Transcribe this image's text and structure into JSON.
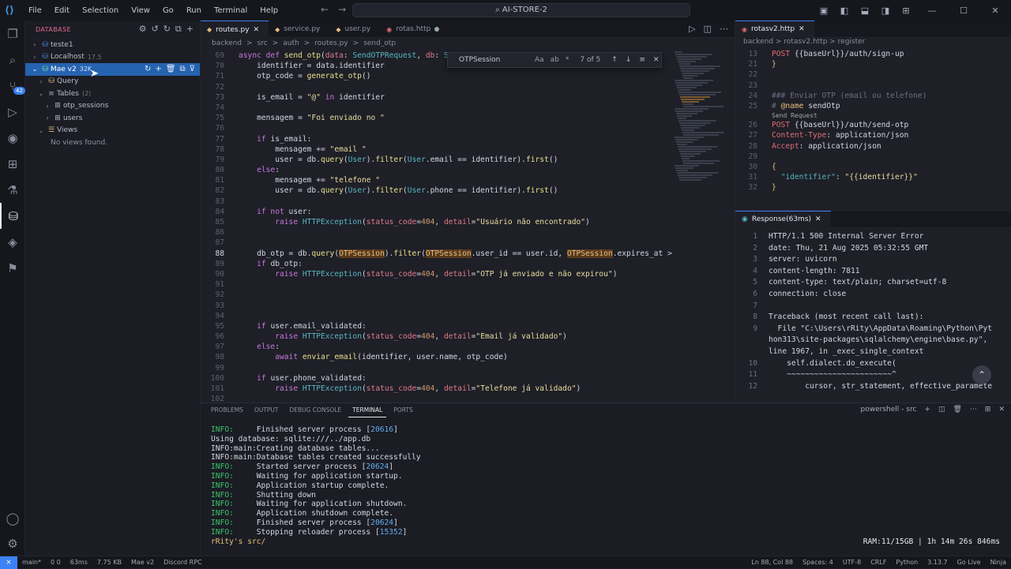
{
  "titlebar": {
    "search": "AI-STORE-2",
    "menu": [
      "File",
      "Edit",
      "Selection",
      "View",
      "Go",
      "Run",
      "Terminal",
      "Help"
    ]
  },
  "sidebar": {
    "title": "DATABASE",
    "connections": [
      {
        "label": "teste1",
        "extra": ""
      },
      {
        "label": "Localhost",
        "extra": "17.5"
      },
      {
        "label": "Mae v2",
        "extra": "32K"
      }
    ],
    "query": "Query",
    "tables_label": "Tables",
    "tables_count": "(2)",
    "tables": [
      "otp_sessions",
      "users"
    ],
    "views": "Views",
    "no_views": "No views found."
  },
  "tabs": [
    {
      "label": "routes.py",
      "type": "py",
      "active": true
    },
    {
      "label": "service.py",
      "type": "py"
    },
    {
      "label": "user.py",
      "type": "py"
    },
    {
      "label": "rotas.http",
      "type": "http",
      "modified": true
    }
  ],
  "breadcrumb": [
    "backend",
    ">",
    "src",
    ">",
    "auth",
    ">",
    "routes.py",
    ">",
    "send_otp"
  ],
  "find": {
    "value": "OTPSession",
    "count": "7 of 5",
    "options": [
      "Aa",
      "ab",
      "*"
    ]
  },
  "code": [
    {
      "n": "69",
      "html": "<span class='kw'>async def</span> <span class='fn'>send_otp</span>(<span class='prm'>data</span>: <span class='cls'>SendOTPRequest</span>, <span class='prm'>db</span>: <span class='cls'>S</span>"
    },
    {
      "n": "70",
      "html": "    identifier = data.identifier"
    },
    {
      "n": "71",
      "html": "    otp_code = <span class='fn'>generate_otp</span>()"
    },
    {
      "n": "72",
      "html": ""
    },
    {
      "n": "73",
      "html": "    is_email = <span class='str'>\"@\"</span> <span class='kw'>in</span> identifier"
    },
    {
      "n": "74",
      "html": ""
    },
    {
      "n": "75",
      "html": "    mensagem = <span class='str'>\"Foi enviado no \"</span>"
    },
    {
      "n": "76",
      "html": ""
    },
    {
      "n": "77",
      "html": "    <span class='kw'>if</span> is_email:"
    },
    {
      "n": "78",
      "html": "        mensagem += <span class='str'>\"email \"</span>"
    },
    {
      "n": "79",
      "html": "        user = db.<span class='fn'>query</span>(<span class='cls'>User</span>).<span class='fn'>filter</span>(<span class='cls'>User</span>.email == identifier).<span class='fn'>first</span>()"
    },
    {
      "n": "80",
      "html": "    <span class='kw'>else</span>:"
    },
    {
      "n": "81",
      "html": "        mensagem += <span class='str'>\"telefone \"</span>"
    },
    {
      "n": "82",
      "html": "        user = db.<span class='fn'>query</span>(<span class='cls'>User</span>).<span class='fn'>filter</span>(<span class='cls'>User</span>.phone == identifier).<span class='fn'>first</span>()"
    },
    {
      "n": "83",
      "html": ""
    },
    {
      "n": "84",
      "html": "    <span class='kw'>if not</span> user:"
    },
    {
      "n": "85",
      "html": "        <span class='kw'>raise</span> <span class='cls'>HTTPException</span>(<span class='prm'>status_code</span>=<span class='num'>404</span>, <span class='prm'>detail</span>=<span class='str'>\"Usuário não encontrado\"</span>)"
    },
    {
      "n": "86",
      "html": ""
    },
    {
      "n": "87",
      "html": ""
    },
    {
      "n": "88",
      "html": "    db_otp = db.<span class='fn'>query</span>(<span class='hl'>OTPSession</span>).<span class='fn'>filter</span>(<span class='hl'>OTPSession</span>.user_id == user.id, <span class='hl'>OTPSession</span>.expires_at &gt;",
      "cur": true
    },
    {
      "n": "89",
      "html": "    <span class='kw'>if</span> db_otp:"
    },
    {
      "n": "90",
      "html": "        <span class='kw'>raise</span> <span class='cls'>HTTPException</span>(<span class='prm'>status_code</span>=<span class='num'>404</span>, <span class='prm'>detail</span>=<span class='str'>\"OTP já enviado e não expirou\"</span>)"
    },
    {
      "n": "91",
      "html": ""
    },
    {
      "n": "92",
      "html": ""
    },
    {
      "n": "93",
      "html": ""
    },
    {
      "n": "94",
      "html": ""
    },
    {
      "n": "95",
      "html": "    <span class='kw'>if</span> user.email_validated:"
    },
    {
      "n": "96",
      "html": "        <span class='kw'>raise</span> <span class='cls'>HTTPException</span>(<span class='prm'>status_code</span>=<span class='num'>404</span>, <span class='prm'>detail</span>=<span class='str'>\"Email já validado\"</span>)"
    },
    {
      "n": "97",
      "html": "    <span class='kw'>else</span>:"
    },
    {
      "n": "98",
      "html": "        <span class='kw'>await</span> <span class='fn'>enviar_email</span>(identifier, user.name, otp_code)"
    },
    {
      "n": "99",
      "html": ""
    },
    {
      "n": "100",
      "html": "    <span class='kw'>if</span> user.phone_validated:"
    },
    {
      "n": "101",
      "html": "        <span class='kw'>raise</span> <span class='cls'>HTTPException</span>(<span class='prm'>status_code</span>=<span class='num'>404</span>, <span class='prm'>detail</span>=<span class='str'>\"Telefone já validado\"</span>)"
    },
    {
      "n": "102",
      "html": ""
    }
  ],
  "http": {
    "tab": "rotasv2.http",
    "crumb": "backend > rotasv2.http > register",
    "codelens": "Send Request",
    "lines": [
      {
        "n": "13",
        "html": "<span class='hk'>POST</span> <span class='hv'>{{baseUrl}}/auth/sign-up</span>"
      },
      {
        "n": "21",
        "html": "<span class='hb'>}</span>"
      },
      {
        "n": "22",
        "html": ""
      },
      {
        "n": "23",
        "html": ""
      },
      {
        "n": "24",
        "html": "<span class='cm'>### Enviar OTP (email ou telefone)</span>"
      },
      {
        "n": "25",
        "html": "<span class='cm'># </span><span class='hb'>@name</span> <span class='hv'>sendOtp</span>"
      },
      {
        "n": "26",
        "html": "<span class='hk'>POST</span> <span class='hv'>{{baseUrl}}/auth/send-otp</span>"
      },
      {
        "n": "27",
        "html": "<span class='hk'>Content-Type</span>: <span class='hv'>application/json</span>"
      },
      {
        "n": "28",
        "html": "<span class='hk'>Accept</span>: <span class='hv'>application/json</span>"
      },
      {
        "n": "29",
        "html": ""
      },
      {
        "n": "30",
        "html": "<span class='hb'>{</span>"
      },
      {
        "n": "31",
        "html": "  <span class='cls'>\"identifier\"</span>: <span class='str'>\"{{identifier}}\"</span>"
      },
      {
        "n": "32",
        "html": "<span class='hb'>}</span>"
      }
    ]
  },
  "response": {
    "tab": "Response(63ms)",
    "lines": [
      {
        "n": "1",
        "t": "HTTP/1.1 500 Internal Server Error"
      },
      {
        "n": "2",
        "t": "date: Thu, 21 Aug 2025 05:32:55 GMT"
      },
      {
        "n": "3",
        "t": "server: uvicorn"
      },
      {
        "n": "4",
        "t": "content-length: 7811"
      },
      {
        "n": "5",
        "t": "content-type: text/plain; charset=utf-8"
      },
      {
        "n": "6",
        "t": "connection: close"
      },
      {
        "n": "7",
        "t": ""
      },
      {
        "n": "8",
        "t": "Traceback (most recent call last):"
      },
      {
        "n": "9",
        "t": "  File \"C:\\Users\\rRity\\AppData\\Roaming\\Python\\Pyt"
      },
      {
        "n": "",
        "t": "hon313\\site-packages\\sqlalchemy\\engine\\base.py\","
      },
      {
        "n": "",
        "t": "line 1967, in _exec_single_context"
      },
      {
        "n": "10",
        "t": "    self.dialect.do_execute("
      },
      {
        "n": "11",
        "t": "    ~~~~~~~~~~~~~~~~~~~~~~~^"
      },
      {
        "n": "12",
        "t": "        cursor, str_statement, effective_paramete"
      }
    ]
  },
  "panel": {
    "tabs": [
      "PROBLEMS",
      "OUTPUT",
      "DEBUG CONSOLE",
      "TERMINAL",
      "PORTS"
    ],
    "active": "TERMINAL",
    "shell": "powershell - src"
  },
  "terminal": [
    {
      "p": "INFO:",
      "t": "     Finished server process [",
      "b": "20616",
      "e": "]"
    },
    {
      "p": "",
      "t": "Using database: sqlite:///../app.db",
      "b": "",
      "e": ""
    },
    {
      "p": "",
      "t": "INFO:main:Creating database tables...",
      "b": "",
      "e": ""
    },
    {
      "p": "",
      "t": "INFO:main:Database tables created successfully",
      "b": "",
      "e": ""
    },
    {
      "p": "INFO:",
      "t": "     Started server process [",
      "b": "20624",
      "e": "]"
    },
    {
      "p": "INFO:",
      "t": "     Waiting for application startup.",
      "b": "",
      "e": ""
    },
    {
      "p": "INFO:",
      "t": "     Application startup complete.",
      "b": "",
      "e": ""
    },
    {
      "p": "INFO:",
      "t": "     Shutting down",
      "b": "",
      "e": ""
    },
    {
      "p": "INFO:",
      "t": "     Waiting for application shutdown.",
      "b": "",
      "e": ""
    },
    {
      "p": "INFO:",
      "t": "     Application shutdown complete.",
      "b": "",
      "e": ""
    },
    {
      "p": "INFO:",
      "t": "     Finished server process [",
      "b": "20624",
      "e": "]"
    },
    {
      "p": "INFO:",
      "t": "     Stopping reloader process [",
      "b": "15352",
      "e": "]"
    },
    {
      "p": "",
      "t": "rRity's src/",
      "b": "",
      "e": ""
    }
  ],
  "term_right": "RAM:11/15GB | 1h 14m 26s 846ms",
  "status": {
    "left": [
      "main*",
      "0 0",
      "63ms",
      "7.75 KB",
      "Mae v2",
      "Discord RPC"
    ],
    "right": [
      "Ln 88, Col 88",
      "Spaces: 4",
      "UTF-8",
      "CRLF",
      "Python",
      "3.13.7",
      "Go Live",
      "Ninja"
    ]
  }
}
